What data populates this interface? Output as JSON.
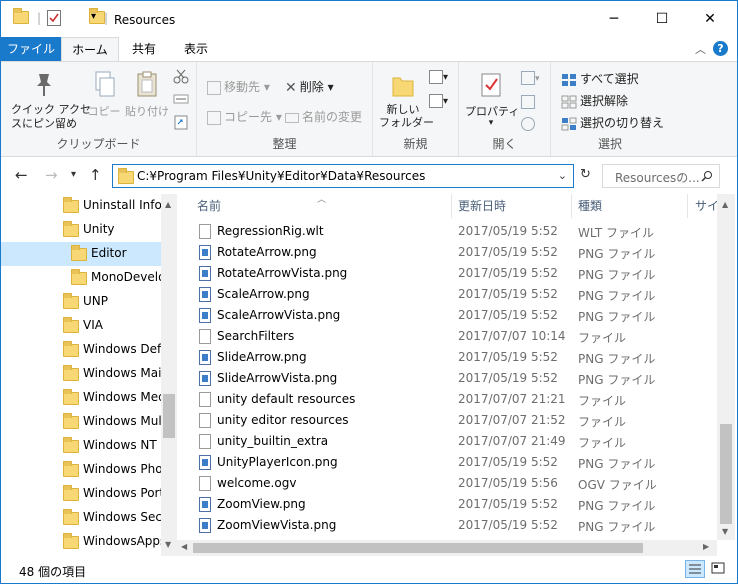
{
  "window": {
    "title": "Resources",
    "minimize": "─",
    "maximize": "☐",
    "close": "✕"
  },
  "ribbon_tabs": {
    "file": "ファイル",
    "home": "ホーム",
    "share": "共有",
    "view": "表示"
  },
  "ribbon": {
    "pin_quick_line1": "クイック アクセ",
    "pin_quick_line2": "スにピン留め",
    "copy": "コピー",
    "paste": "貼り付け",
    "clipboard": "クリップボード",
    "move_to": "移動先",
    "copy_to": "コピー先",
    "delete": "削除",
    "rename": "名前の変更",
    "organize": "整理",
    "new_folder_line1": "新しい",
    "new_folder_line2": "フォルダー",
    "new": "新規",
    "properties": "プロパティ",
    "open": "開く",
    "select_all": "すべて選択",
    "select_none": "選択解除",
    "invert_selection": "選択の切り替え",
    "select": "選択"
  },
  "address": {
    "path": "C:¥Program Files¥Unity¥Editor¥Data¥Resources",
    "search_placeholder": "Resourcesの..."
  },
  "nav_items": [
    {
      "label": "Uninstall Infor",
      "indent": 0,
      "selected": false
    },
    {
      "label": "Unity",
      "indent": 0,
      "selected": false
    },
    {
      "label": "Editor",
      "indent": 1,
      "selected": true
    },
    {
      "label": "MonoDevelo",
      "indent": 1,
      "selected": false
    },
    {
      "label": "UNP",
      "indent": 0,
      "selected": false
    },
    {
      "label": "VIA",
      "indent": 0,
      "selected": false
    },
    {
      "label": "Windows Defe",
      "indent": 0,
      "selected": false
    },
    {
      "label": "Windows Mail",
      "indent": 0,
      "selected": false
    },
    {
      "label": "Windows Med",
      "indent": 0,
      "selected": false
    },
    {
      "label": "Windows Mult",
      "indent": 0,
      "selected": false
    },
    {
      "label": "Windows NT",
      "indent": 0,
      "selected": false
    },
    {
      "label": "Windows Phot",
      "indent": 0,
      "selected": false
    },
    {
      "label": "Windows Porta",
      "indent": 0,
      "selected": false
    },
    {
      "label": "Windows Secu",
      "indent": 0,
      "selected": false
    },
    {
      "label": "WindowsApps",
      "indent": 0,
      "selected": false
    }
  ],
  "columns": {
    "name": "名前",
    "date": "更新日時",
    "type": "種類",
    "size": "サイ"
  },
  "files": [
    {
      "name": "RegressionRig.wlt",
      "date": "2017/05/19 5:52",
      "type": "WLT ファイル",
      "icon": "file"
    },
    {
      "name": "RotateArrow.png",
      "date": "2017/05/19 5:52",
      "type": "PNG ファイル",
      "icon": "png"
    },
    {
      "name": "RotateArrowVista.png",
      "date": "2017/05/19 5:52",
      "type": "PNG ファイル",
      "icon": "png"
    },
    {
      "name": "ScaleArrow.png",
      "date": "2017/05/19 5:52",
      "type": "PNG ファイル",
      "icon": "png"
    },
    {
      "name": "ScaleArrowVista.png",
      "date": "2017/05/19 5:52",
      "type": "PNG ファイル",
      "icon": "png"
    },
    {
      "name": "SearchFilters",
      "date": "2017/07/07 10:14",
      "type": "ファイル",
      "icon": "file"
    },
    {
      "name": "SlideArrow.png",
      "date": "2017/05/19 5:52",
      "type": "PNG ファイル",
      "icon": "png"
    },
    {
      "name": "SlideArrowVista.png",
      "date": "2017/05/19 5:52",
      "type": "PNG ファイル",
      "icon": "png"
    },
    {
      "name": "unity default resources",
      "date": "2017/07/07 21:21",
      "type": "ファイル",
      "icon": "file"
    },
    {
      "name": "unity editor resources",
      "date": "2017/07/07 21:52",
      "type": "ファイル",
      "icon": "file"
    },
    {
      "name": "unity_builtin_extra",
      "date": "2017/07/07 21:49",
      "type": "ファイル",
      "icon": "file"
    },
    {
      "name": "UnityPlayerIcon.png",
      "date": "2017/05/19 5:52",
      "type": "PNG ファイル",
      "icon": "png"
    },
    {
      "name": "welcome.ogv",
      "date": "2017/05/19 5:56",
      "type": "OGV ファイル",
      "icon": "file"
    },
    {
      "name": "ZoomView.png",
      "date": "2017/05/19 5:52",
      "type": "PNG ファイル",
      "icon": "png"
    },
    {
      "name": "ZoomViewVista.png",
      "date": "2017/05/19 5:52",
      "type": "PNG ファイル",
      "icon": "png"
    }
  ],
  "status": {
    "item_count": "48 個の項目"
  }
}
